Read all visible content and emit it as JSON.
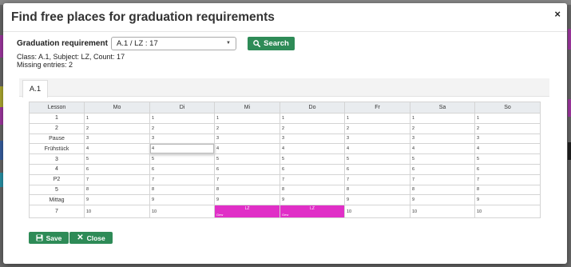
{
  "modal": {
    "title": "Find free places for graduation requirements",
    "close_glyph": "×"
  },
  "requirement": {
    "label": "Graduation requirement",
    "value": "A.1 / LZ : 17",
    "search_label": "Search"
  },
  "info": {
    "line1": "Class: A.1, Subject: LZ, Count: 17",
    "line2": "Missing entries: 2"
  },
  "tabs": [
    {
      "label": "A.1"
    }
  ],
  "table": {
    "headers": [
      "Lesson",
      "Mo",
      "Di",
      "Mi",
      "Do",
      "Fr",
      "Sa",
      "So"
    ],
    "rows": [
      {
        "lesson": "1",
        "cells": [
          "1",
          "1",
          "1",
          "1",
          "1",
          "1",
          "1"
        ]
      },
      {
        "lesson": "2",
        "cells": [
          "2",
          "2",
          "2",
          "2",
          "2",
          "2",
          "2"
        ]
      },
      {
        "lesson": "Pause",
        "cells": [
          "3",
          "3",
          "3",
          "3",
          "3",
          "3",
          "3"
        ]
      },
      {
        "lesson": "Frühstück",
        "cells": [
          "4",
          "4",
          "4",
          "4",
          "4",
          "4",
          "4"
        ]
      },
      {
        "lesson": "3",
        "cells": [
          "5",
          "5",
          "5",
          "5",
          "5",
          "5",
          "5"
        ]
      },
      {
        "lesson": "4",
        "cells": [
          "6",
          "6",
          "6",
          "6",
          "6",
          "6",
          "6"
        ]
      },
      {
        "lesson": "P2",
        "cells": [
          "7",
          "7",
          "7",
          "7",
          "7",
          "7",
          "7"
        ]
      },
      {
        "lesson": "5",
        "cells": [
          "8",
          "8",
          "8",
          "8",
          "8",
          "8",
          "8"
        ]
      },
      {
        "lesson": "Mittag",
        "cells": [
          "9",
          "9",
          "9",
          "9",
          "9",
          "9",
          "9"
        ]
      },
      {
        "lesson": "7",
        "cells": [
          "10",
          "10",
          "",
          "",
          "10",
          "10",
          "10"
        ]
      }
    ],
    "lz_entry": {
      "title": "LZ",
      "sub": "Gew"
    }
  },
  "buttons": {
    "save": "Save",
    "close": "Close"
  },
  "colors": {
    "accent": "#2e8b57",
    "lz_highlight": "#e02fc7"
  }
}
